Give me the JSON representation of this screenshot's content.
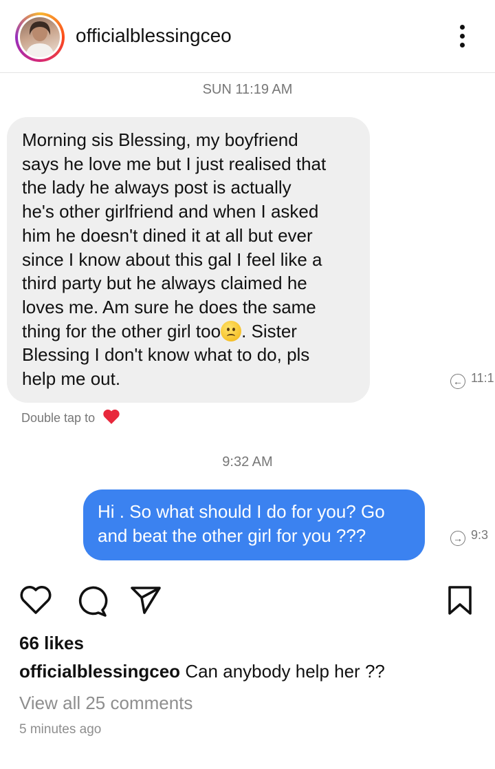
{
  "post": {
    "username": "officialblessingceo",
    "likes": "66 likes",
    "caption_user": "officialblessingceo",
    "caption_text": "Can anybody help her ??",
    "view_comments": "View all 25 comments",
    "time_ago": "5 minutes ago"
  },
  "chat": {
    "timestamp_1": "SUN 11:19 AM",
    "incoming_text_1": "Morning sis Blessing, my boyfriend\nsays he love me but I just realised that\nthe lady he always post is actually\nhe's other girlfriend and when I asked\nhim he doesn't dined it at all but ever\nsince I know about this gal I feel like a\nthird party but he always claimed he\nloves me. Am sure he does the same\nthing for the other girl too",
    "incoming_emoji": "confused-face",
    "incoming_text_2": ". Sister\nBlessing I don't know what to do, pls\nhelp me out.",
    "incoming_time": "11:1",
    "double_tap": "Double tap to",
    "timestamp_2": "9:32 AM",
    "outgoing_text": "Hi . So what should I do for you? Go\nand beat the other girl for you ???",
    "outgoing_time": "9:3"
  },
  "colors": {
    "outgoing_bubble": "#3b82f0",
    "incoming_bubble": "#efefef",
    "heart_red": "#e8283c"
  },
  "icons": {
    "more": "vertical-ellipsis-icon",
    "like": "heart-outline-icon",
    "comment": "comment-bubble-icon",
    "share": "paper-plane-icon",
    "save": "bookmark-icon"
  }
}
